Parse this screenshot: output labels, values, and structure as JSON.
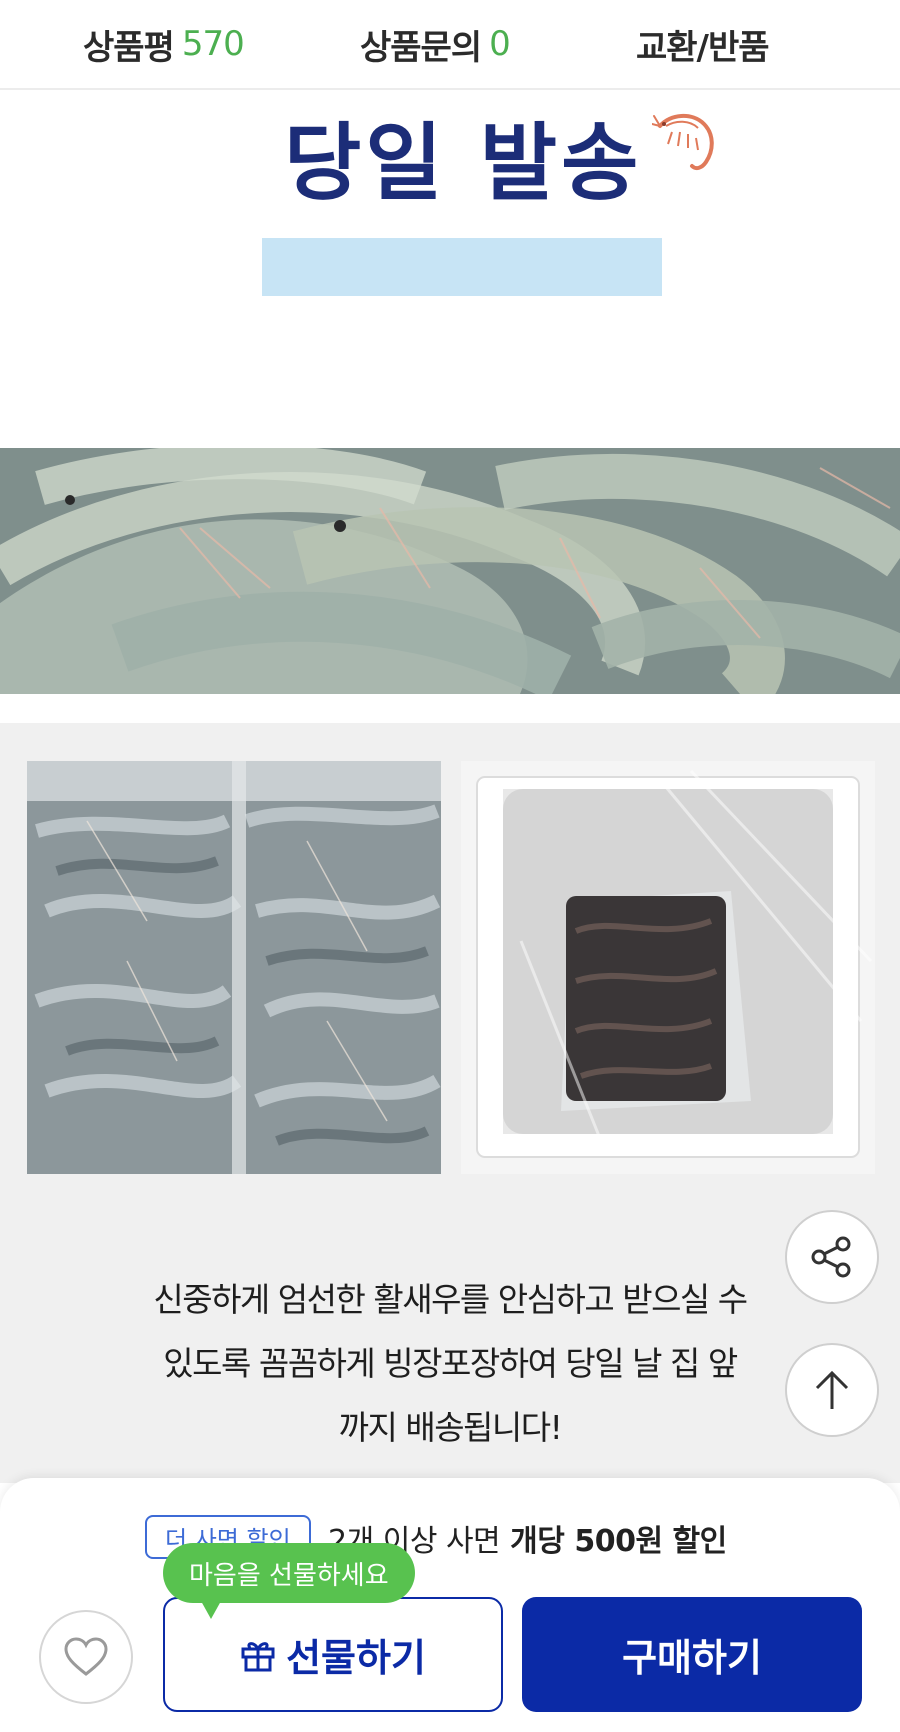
{
  "tabs": {
    "review_label": "상품평",
    "review_count": "570",
    "qna_label": "상품문의",
    "qna_count": "0",
    "return_label": "교환/반품"
  },
  "banner": {
    "title": "당일 발송",
    "highlight_color": "#c7e4f5",
    "title_color": "#1c2d78",
    "decoration_icon": "shrimp-icon"
  },
  "images": {
    "main": "live-shrimp-photo",
    "bag": "bagged-shrimp-photo",
    "box": "ice-box-packaging-photo"
  },
  "description": {
    "line1": "신중하게 엄선한 활새우를 안심하고 받으실 수",
    "line2": "있도록 꼼꼼하게 빙장포장하여 당일 날 집 앞",
    "line3": "까지 배송됩니다!"
  },
  "floating": {
    "share_icon": "share-icon",
    "top_icon": "arrow-up-icon"
  },
  "purchase_bar": {
    "discount_badge": "더 사면 할인",
    "discount_prefix": "2개 이상 사면",
    "discount_bold": "개당 500원 할인",
    "gift_tooltip": "마음을 선물하세요",
    "gift_label": "선물하기",
    "buy_label": "구매하기",
    "accent_color": "#0b2aa6",
    "tooltip_color": "#58c24f"
  }
}
